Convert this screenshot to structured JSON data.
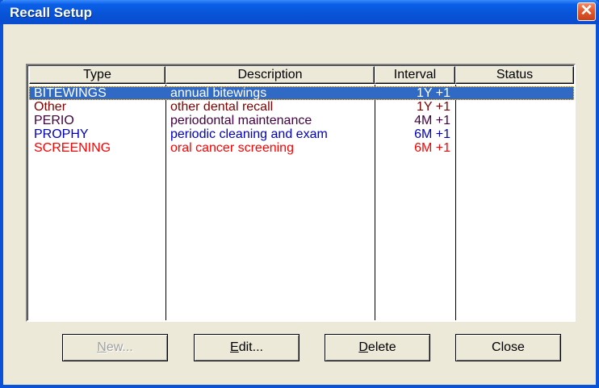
{
  "window": {
    "title": "Recall Setup",
    "close_glyph": "✕"
  },
  "columns": [
    "Type",
    "Description",
    "Interval",
    "Status"
  ],
  "rows": [
    {
      "type": "BITEWINGS",
      "description": "annual bitewings",
      "interval": "1Y +1",
      "status": "",
      "color": "#ffffff",
      "selected": true
    },
    {
      "type": "Other",
      "description": "other dental recall",
      "interval": "1Y +1",
      "status": "",
      "color": "#800000",
      "selected": false
    },
    {
      "type": "PERIO",
      "description": "periodontal maintenance",
      "interval": "4M +1",
      "status": "",
      "color": "#400040",
      "selected": false
    },
    {
      "type": "PROPHY",
      "description": "periodic cleaning and exam",
      "interval": "6M +1",
      "status": "",
      "color": "#0000c0",
      "selected": false
    },
    {
      "type": "SCREENING",
      "description": "oral cancer screening",
      "interval": "6M +1",
      "status": "",
      "color": "#ff0000",
      "selected": false
    }
  ],
  "buttons": {
    "new": {
      "accel": "N",
      "rest": "ew...",
      "enabled": false
    },
    "edit": {
      "accel": "E",
      "rest": "dit...",
      "enabled": true
    },
    "delete": {
      "accel": "D",
      "rest": "elete",
      "enabled": true
    },
    "close": {
      "label": "Close",
      "enabled": true
    }
  },
  "colors": {
    "selection": "#316ac5",
    "titlebar": "#0853d6"
  }
}
